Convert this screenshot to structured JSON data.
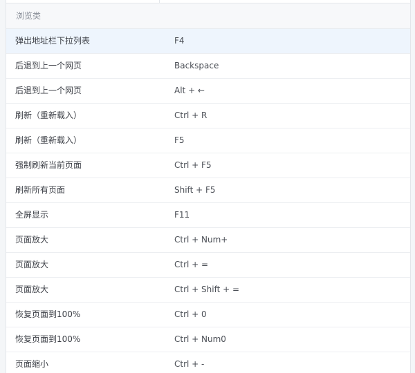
{
  "section": {
    "title": "浏览类"
  },
  "rows": [
    {
      "action": "弹出地址栏下拉列表",
      "key": "F4"
    },
    {
      "action": "后退到上一个网页",
      "key": "Backspace"
    },
    {
      "action": "后退到上一个网页",
      "key": "Alt + ←"
    },
    {
      "action": "刷新（重新载入）",
      "key": "Ctrl + R"
    },
    {
      "action": "刷新（重新载入）",
      "key": "F5"
    },
    {
      "action": "强制刷新当前页面",
      "key": "Ctrl + F5"
    },
    {
      "action": "刷新所有页面",
      "key": "Shift + F5"
    },
    {
      "action": "全屏显示",
      "key": "F11"
    },
    {
      "action": "页面放大",
      "key": "Ctrl + Num+"
    },
    {
      "action": "页面放大",
      "key": "Ctrl + ="
    },
    {
      "action": "页面放大",
      "key": "Ctrl + Shift + ="
    },
    {
      "action": "恢复页面到100%",
      "key": "Ctrl + 0"
    },
    {
      "action": "恢复页面到100%",
      "key": "Ctrl + Num0"
    },
    {
      "action": "页面缩小",
      "key": "Ctrl + -"
    }
  ],
  "colors": {
    "highlight_row": "#eef5fd",
    "section_bg": "#f7f8fa"
  }
}
